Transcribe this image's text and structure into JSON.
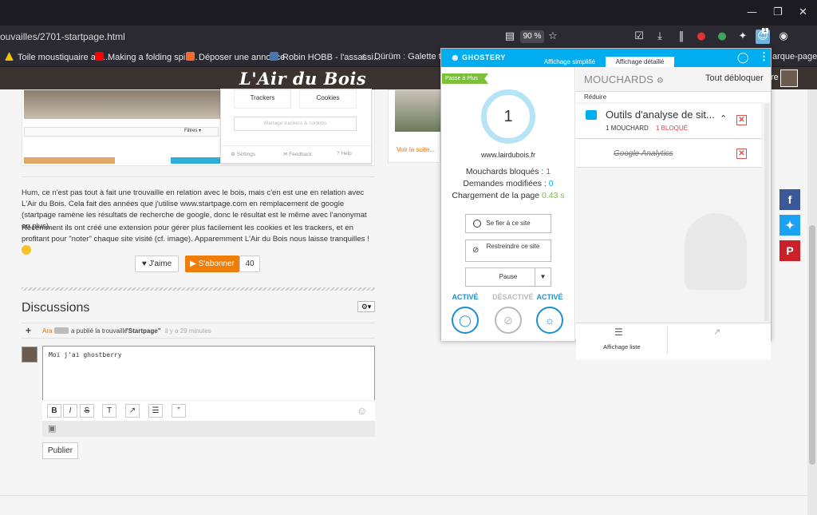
{
  "browser": {
    "url": "ouvailles/2701-startpage.html",
    "zoom": "90 %",
    "window_controls": [
      "—",
      "❐",
      "✕"
    ],
    "extension_badge": "1",
    "bookmarks": [
      {
        "label": "Toile moustiquaire ant...",
        "color": "#f2c200"
      },
      {
        "label": "Making a folding spin...",
        "color": "#ff0000"
      },
      {
        "label": "Déposer une annonce",
        "color": "#f56b2a"
      },
      {
        "label": "Robin HOBB - l'assassi...",
        "color": "#4a76a8"
      },
      {
        "label": "Dürüm : Galette turqu...",
        "color": "#ffffff"
      },
      {
        "label": "arque-pages",
        "color": ""
      }
    ]
  },
  "site": {
    "logo": "L'Air du Bois",
    "header_right": "re",
    "card_embed": {
      "trackers_label": "Trackers",
      "cookies_label": "Cookies",
      "manage_label": "Manage trackers & cookies",
      "settings_label": "Settings",
      "feedback_label": "Feedback",
      "help_label": "Help",
      "filters_label": "Filtres ▾"
    },
    "read_more": "Voir la suite...",
    "paragraph1": "Hum, ce n'est pas tout à fait une trouvaille en relation avec le bois, mais c'en est une en relation avec L'Air du Bois. Cela fait des années que j'utilise www.startpage.com en remplacement de google (startpage ramène les résultats de recherche de google, donc le résultat est le même avec l'anonymat en plus).",
    "paragraph2": "Récemment ils ont créé une extension pour gérer plus facilement les cookies et les trackers, et en profitant pour \"noter\" chaque site visité (cf. image). Apparemment L'Air du Bois nous laisse tranquilles !",
    "like_label": "J'aime",
    "subscribe_label": "S'abonner",
    "subscribe_count": "40",
    "discussions_title": "Discussions",
    "activity": {
      "user": "Ara",
      "text": "a publié la trouvaille",
      "item": "\"Startpage\"",
      "time": "il y a 29 minutes"
    },
    "comment_text": "Moi j'ai ghostberry",
    "editor_buttons": [
      "B",
      "I",
      "S",
      "T",
      "↗",
      "☰",
      "”"
    ],
    "publish_label": "Publier",
    "share_colors": {
      "facebook": "#3b5998",
      "twitter": "#1da1f2",
      "pinterest": "#cb2027"
    }
  },
  "ghostery": {
    "brand": "GHOSTERY",
    "tab_simple": "Affichage simplifié",
    "tab_detailed": "Affichage détaillé",
    "plus_badge": "Passe à Plus",
    "tracker_count": "1",
    "domain": "www.lairdubois.fr",
    "blocked_label": "Mouchards bloqués :",
    "blocked_value": "1",
    "modified_label": "Demandes modifiées :",
    "modified_value": "0",
    "load_label": "Chargement de la page",
    "load_value": "0.43 s",
    "trust_label": "Se fier à ce site",
    "restrict_label": "Restreindre ce site",
    "pause_label": "Pause",
    "modes": [
      "ACTIVÉ",
      "DÉSACTIVÉ",
      "ACTIVÉ"
    ],
    "trackers_title": "MOUCHARDS",
    "unblock_all": "Tout débloquer",
    "reduce_label": "Réduire",
    "category_title": "Outils d'analyse de sit...",
    "category_count": "1 MOUCHARD",
    "category_blocked": "1 BLOQUÉ",
    "tracker_name": "Google Analytics",
    "list_view_label": "Affichage liste",
    "colors": {
      "accent": "#00aef0",
      "blocked": "#e8404a",
      "modified": "#00aef0",
      "load": "#7bbf3a",
      "active": "#1c8fd0",
      "disabled": "#b9b9b9"
    }
  }
}
